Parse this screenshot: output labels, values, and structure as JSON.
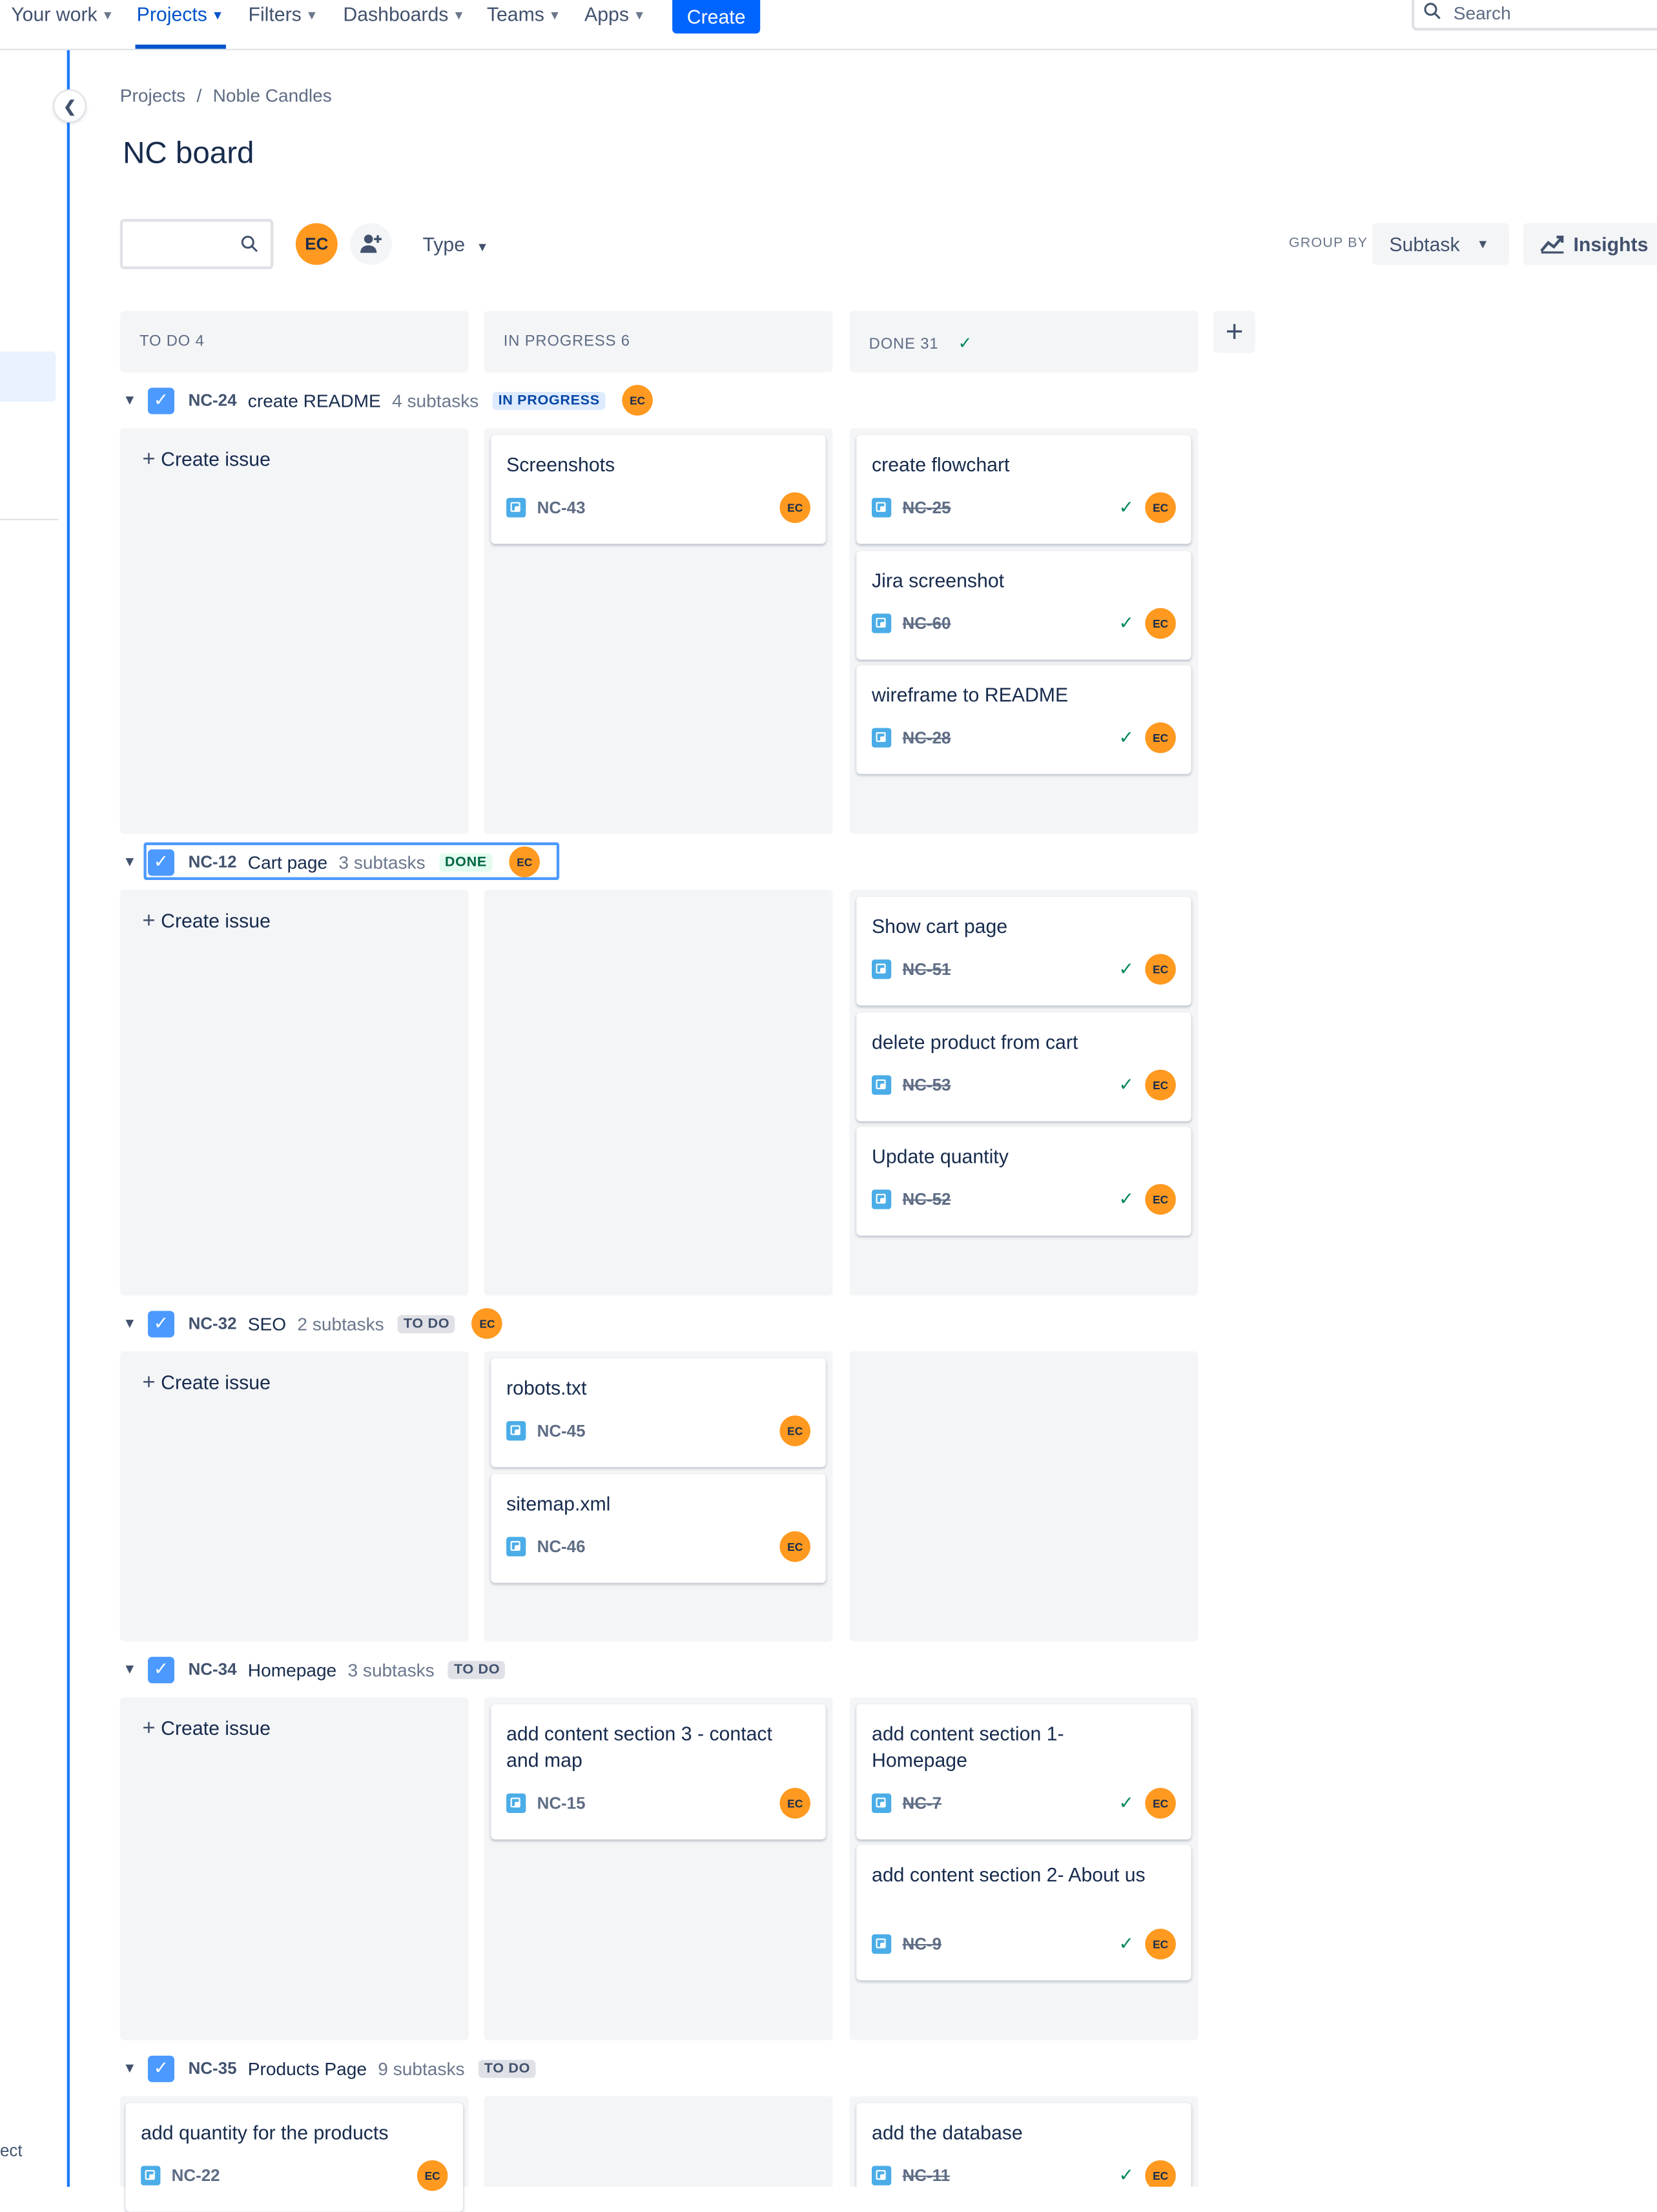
{
  "nav": {
    "items": [
      "Your work",
      "Projects",
      "Filters",
      "Dashboards",
      "Teams",
      "Apps"
    ],
    "create_label": "Create",
    "search_placeholder": "Search"
  },
  "sidebar": {
    "footer_text": "ect"
  },
  "breadcrumb": {
    "projects": "Projects",
    "separator": "/",
    "project": "Noble Candles"
  },
  "page_title": "NC board",
  "toolbar": {
    "avatar_initials": "EC",
    "type_filter": "Type",
    "group_by_label": "GROUP BY",
    "group_by_value": "Subtask",
    "insights_label": "Insights"
  },
  "columns": [
    {
      "label": "TO DO 4"
    },
    {
      "label": "IN PROGRESS 6"
    },
    {
      "label": "DONE 31"
    }
  ],
  "create_issue_label": "Create issue",
  "swimlanes": [
    {
      "key": "NC-24",
      "summary": "create README",
      "count": "4 subtasks",
      "status": "IN PROGRESS",
      "avatar": "EC",
      "in_progress": [
        {
          "title": "Screenshots",
          "key": "NC-43",
          "avatar": "EC"
        }
      ],
      "done": [
        {
          "title": "create flowchart",
          "key": "NC-25",
          "avatar": "EC"
        },
        {
          "title": "Jira screenshot",
          "key": "NC-60",
          "avatar": "EC"
        },
        {
          "title": "wireframe to README",
          "key": "NC-28",
          "avatar": "EC"
        }
      ]
    },
    {
      "key": "NC-12",
      "summary": "Cart page",
      "count": "3 subtasks",
      "status": "DONE",
      "avatar": "EC",
      "done": [
        {
          "title": "Show cart page",
          "key": "NC-51",
          "avatar": "EC"
        },
        {
          "title": "delete product from cart",
          "key": "NC-53",
          "avatar": "EC"
        },
        {
          "title": "Update quantity",
          "key": "NC-52",
          "avatar": "EC"
        }
      ]
    },
    {
      "key": "NC-32",
      "summary": "SEO",
      "count": "2 subtasks",
      "status": "TO DO",
      "avatar": "EC",
      "in_progress": [
        {
          "title": "robots.txt",
          "key": "NC-45",
          "avatar": "EC"
        },
        {
          "title": "sitemap.xml",
          "key": "NC-46",
          "avatar": "EC"
        }
      ]
    },
    {
      "key": "NC-34",
      "summary": "Homepage",
      "count": "3 subtasks",
      "status": "TO DO",
      "in_progress": [
        {
          "title": "add content section 3 - contact and map",
          "key": "NC-15",
          "avatar": "EC"
        }
      ],
      "done": [
        {
          "title": "add content section 1- Homepage",
          "key": "NC-7",
          "avatar": "EC"
        },
        {
          "title": "add content section 2- About us",
          "key": "NC-9",
          "avatar": "EC"
        }
      ]
    },
    {
      "key": "NC-35",
      "summary": "Products Page",
      "count": "9 subtasks",
      "status": "TO DO",
      "todo": [
        {
          "title": "add quantity for the products",
          "key": "NC-22",
          "avatar": "EC"
        }
      ],
      "done": [
        {
          "title": "add the database",
          "key": "NC-11",
          "avatar": "EC"
        }
      ]
    }
  ],
  "colors": {
    "accent": "#0052CC",
    "create": "#0065FF",
    "avatar": "#FF991F",
    "done_check": "#00875A"
  }
}
